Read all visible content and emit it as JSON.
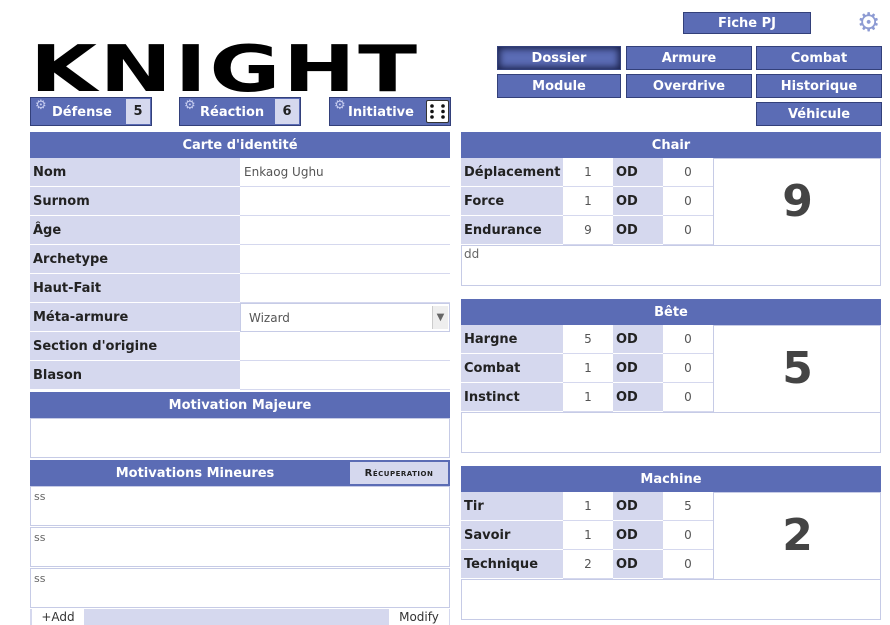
{
  "top": {
    "fiche_label": "Fiche PJ"
  },
  "logo": {
    "text": "KNIGHT"
  },
  "nav": {
    "row1": [
      "Dossier",
      "Armure",
      "Combat"
    ],
    "row2": [
      "Module",
      "Overdrive",
      "Historique"
    ],
    "row3": [
      "Véhicule"
    ],
    "active": "Dossier"
  },
  "stats": {
    "defense": {
      "label": "Défense",
      "value": "5"
    },
    "reaction": {
      "label": "Réaction",
      "value": "6"
    },
    "initiative": {
      "label": "Initiative"
    }
  },
  "identity": {
    "header": "Carte d'identité",
    "rows": [
      {
        "label": "Nom",
        "value": "Enkaog Ughu"
      },
      {
        "label": "Surnom",
        "value": ""
      },
      {
        "label": "Âge",
        "value": ""
      },
      {
        "label": "Archetype",
        "value": ""
      },
      {
        "label": "Haut-Fait",
        "value": ""
      },
      {
        "label": "Méta-armure",
        "value": "Wizard"
      },
      {
        "label": "Section d'origine",
        "value": ""
      },
      {
        "label": "Blason",
        "value": ""
      }
    ]
  },
  "motivation_majeure": {
    "header": "Motivation Majeure",
    "value": ""
  },
  "motivations_mineures": {
    "header": "Motivations Mineures",
    "recuperation": "Récuperation",
    "items": [
      "ss",
      "ss",
      "ss"
    ],
    "add": "+Add",
    "modify": "Modify"
  },
  "aspects": [
    {
      "name": "Chair",
      "total": "9",
      "note": "dd",
      "rows": [
        {
          "label": "Déplacement",
          "value": "1",
          "od_label": "OD",
          "od": "0"
        },
        {
          "label": "Force",
          "value": "1",
          "od_label": "OD",
          "od": "0"
        },
        {
          "label": "Endurance",
          "value": "9",
          "od_label": "OD",
          "od": "0"
        }
      ]
    },
    {
      "name": "Bête",
      "total": "5",
      "note": "",
      "rows": [
        {
          "label": "Hargne",
          "value": "5",
          "od_label": "OD",
          "od": "0"
        },
        {
          "label": "Combat",
          "value": "1",
          "od_label": "OD",
          "od": "0"
        },
        {
          "label": "Instinct",
          "value": "1",
          "od_label": "OD",
          "od": "0"
        }
      ]
    },
    {
      "name": "Machine",
      "total": "2",
      "note": "",
      "rows": [
        {
          "label": "Tir",
          "value": "1",
          "od_label": "OD",
          "od": "5"
        },
        {
          "label": "Savoir",
          "value": "1",
          "od_label": "OD",
          "od": "0"
        },
        {
          "label": "Technique",
          "value": "2",
          "od_label": "OD",
          "od": "0"
        }
      ]
    }
  ],
  "colors": {
    "accent": "#5b6cb5",
    "light": "#d5d8ee"
  }
}
